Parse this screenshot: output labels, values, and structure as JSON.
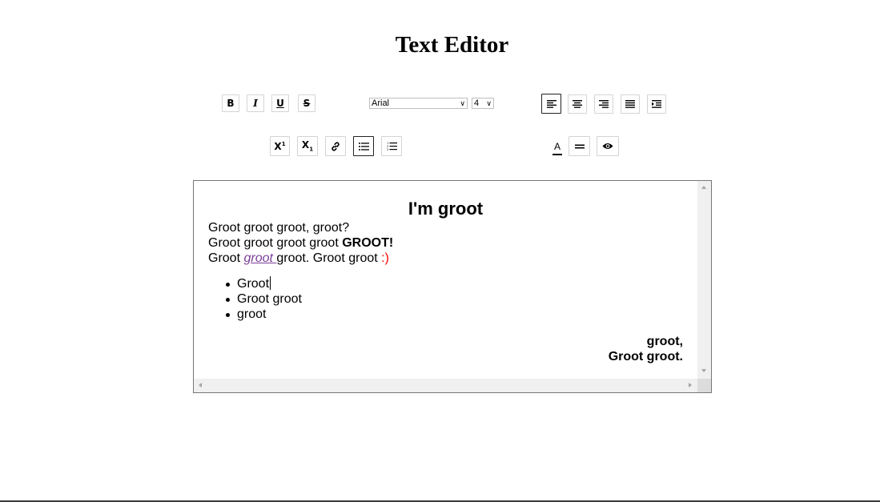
{
  "page": {
    "title": "Text Editor"
  },
  "toolbar": {
    "font_family": {
      "selected": "Arial"
    },
    "font_size": {
      "selected": "4"
    },
    "font_color_label": "A",
    "colors": {
      "font_color_underline": "#000000",
      "active_border": "#222222"
    }
  },
  "editor": {
    "heading": "I'm groot",
    "line1": "Groot groot groot, groot?",
    "line2_plain": "Groot groot groot groot ",
    "line2_bold": "GROOT!",
    "line3_a": "Groot ",
    "line3_link": "groot ",
    "line3_b": "groot. Groot groot ",
    "line3_smile": ":)",
    "bullets": [
      "Groot",
      "Groot groot",
      "groot"
    ],
    "sign_line1": "groot,",
    "sign_line2": "Groot groot.",
    "colors": {
      "link": "#7b3f99",
      "smile": "#ff0000"
    }
  }
}
